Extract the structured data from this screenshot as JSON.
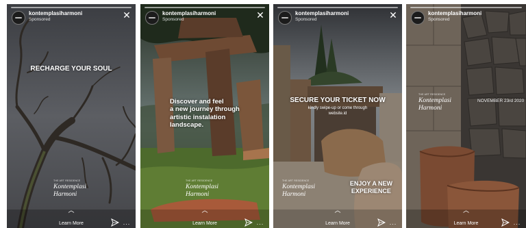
{
  "common": {
    "account": "kontemplasiharmoni",
    "sponsored": "Sponsored",
    "close_glyph": "✕",
    "chevron_glyph": "︿",
    "learn_more": "Learn More",
    "more_glyph": "···",
    "brand_pre": "THE ART RESIDENCE",
    "brand_line1": "Kontemplasi",
    "brand_line2": "Harmoni",
    "icons": [
      "close-icon",
      "chevron-up-icon",
      "send-icon",
      "more-icon"
    ]
  },
  "stories": [
    {
      "headline": "RECHARGE YOUR SOUL",
      "background": "#4f5055"
    },
    {
      "headline_lines": [
        "Discover and feel",
        "a new journey through",
        "artistic instalation",
        "landscape."
      ],
      "background": "#2f3a2a"
    },
    {
      "headline": "SECURE YOUR TICKET NOW",
      "subtext_lines": [
        "kindly swipe-up or come through",
        "website.id"
      ],
      "cta_lines": [
        "ENJOY A NEW",
        "EXPERIENCE"
      ],
      "background": "#5b5a55"
    },
    {
      "date": "NOVEMBER 23rd 2020",
      "background": "#3a3633"
    }
  ]
}
